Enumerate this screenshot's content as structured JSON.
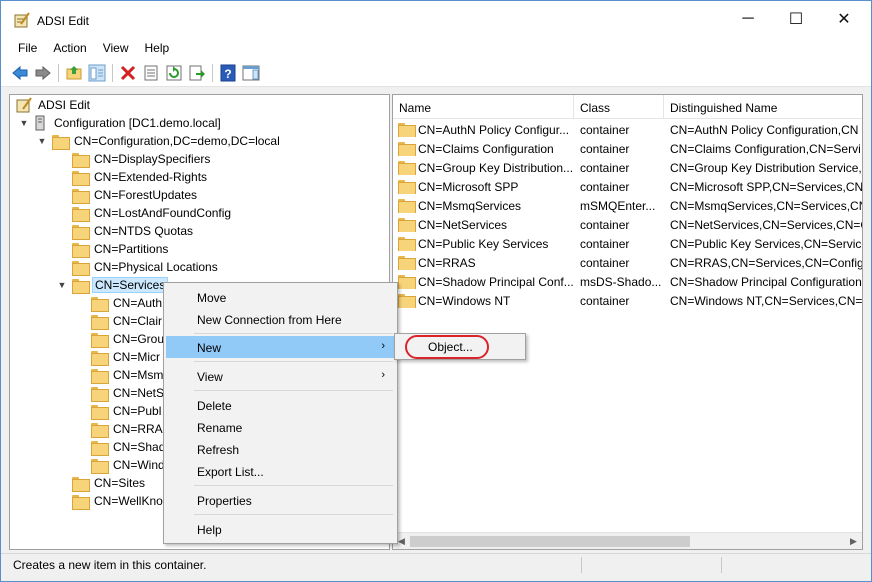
{
  "window": {
    "title": "ADSI Edit",
    "minimize": "─",
    "maximize": "☐",
    "close": "✕"
  },
  "menu": [
    "File",
    "Action",
    "View",
    "Help"
  ],
  "toolbar": {
    "buttons": [
      "back-icon",
      "forward-icon",
      "up-folder-icon",
      "show-hide-tree-icon",
      "delete-icon",
      "properties-icon",
      "refresh-icon",
      "export-list-icon",
      "help-icon",
      "action-pane-icon"
    ]
  },
  "tree": {
    "root": "ADSI Edit",
    "configuration": "Configuration [DC1.demo.local]",
    "config_dn": "CN=Configuration,DC=demo,DC=local",
    "children": [
      "CN=DisplaySpecifiers",
      "CN=Extended-Rights",
      "CN=ForestUpdates",
      "CN=LostAndFoundConfig",
      "CN=NTDS Quotas",
      "CN=Partitions",
      "CN=Physical Locations"
    ],
    "services": "CN=Services",
    "service_children": [
      "CN=Auth",
      "CN=Clair",
      "CN=Grou",
      "CN=Micr",
      "CN=Msm",
      "CN=NetS",
      "CN=Publ",
      "CN=RRAS",
      "CN=Shad",
      "CN=Wind"
    ],
    "after": [
      "CN=Sites",
      "CN=WellKno"
    ]
  },
  "list": {
    "columns": [
      "Name",
      "Class",
      "Distinguished Name"
    ],
    "rows": [
      {
        "name": "CN=AuthN Policy Configur...",
        "class": "container",
        "dn": "CN=AuthN Policy Configuration,CN"
      },
      {
        "name": "CN=Claims Configuration",
        "class": "container",
        "dn": "CN=Claims Configuration,CN=Servi"
      },
      {
        "name": "CN=Group Key Distribution...",
        "class": "container",
        "dn": "CN=Group Key Distribution Service,C"
      },
      {
        "name": "CN=Microsoft SPP",
        "class": "container",
        "dn": "CN=Microsoft SPP,CN=Services,CN="
      },
      {
        "name": "CN=MsmqServices",
        "class": "mSMQEnter...",
        "dn": "CN=MsmqServices,CN=Services,CN="
      },
      {
        "name": "CN=NetServices",
        "class": "container",
        "dn": "CN=NetServices,CN=Services,CN=C"
      },
      {
        "name": "CN=Public Key Services",
        "class": "container",
        "dn": "CN=Public Key Services,CN=Service"
      },
      {
        "name": "CN=RRAS",
        "class": "container",
        "dn": "CN=RRAS,CN=Services,CN=Configu"
      },
      {
        "name": "CN=Shadow Principal Conf...",
        "class": "msDS-Shado...",
        "dn": "CN=Shadow Principal Configuration"
      },
      {
        "name": "CN=Windows NT",
        "class": "container",
        "dn": "CN=Windows NT,CN=Services,CN="
      }
    ]
  },
  "context_menu": {
    "move": "Move",
    "new_connection": "New Connection from Here",
    "new": "New",
    "view": "View",
    "delete": "Delete",
    "rename": "Rename",
    "refresh": "Refresh",
    "export": "Export List...",
    "properties": "Properties",
    "help": "Help",
    "arrow": "›"
  },
  "submenu": {
    "object": "Object..."
  },
  "status": "Creates a new item in this container.",
  "colors": {
    "highlight": "#91c9f7",
    "annotation": "#d9242b",
    "selection": "#cce8ff"
  }
}
